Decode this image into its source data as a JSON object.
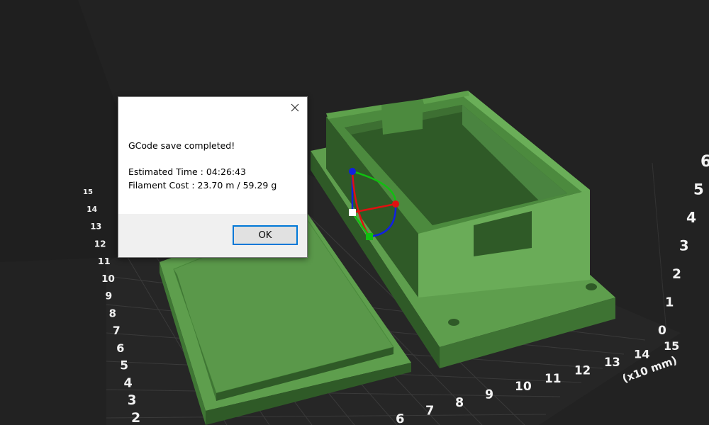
{
  "dialog": {
    "message": "GCode save completed!",
    "estimated_time": "Estimated Time : 04:26:43",
    "filament_cost": "Filament Cost : 23.70 m / 59.29 g",
    "ok_label": "OK",
    "close_icon": "close-icon"
  },
  "viewport": {
    "x_axis_labels": [
      "6",
      "7",
      "8",
      "9",
      "10",
      "11",
      "12",
      "13",
      "14",
      "15"
    ],
    "y_axis_labels": [
      "2",
      "3",
      "4",
      "5",
      "6",
      "7",
      "8",
      "9",
      "10",
      "11",
      "12",
      "13",
      "14",
      "15"
    ],
    "z_axis_labels": [
      "0",
      "1",
      "2",
      "3",
      "4",
      "5",
      "6"
    ],
    "units_label": "(x10 mm)",
    "colors": {
      "background": "#222222",
      "model": "#5e9e4d",
      "model_dark": "#2f5a27",
      "grid": "#3c3c3c"
    },
    "gizmo": {
      "icon": "rotate-gizmo-icon",
      "x_color": "#e01010",
      "y_color": "#10c010",
      "z_color": "#1020e0"
    }
  }
}
